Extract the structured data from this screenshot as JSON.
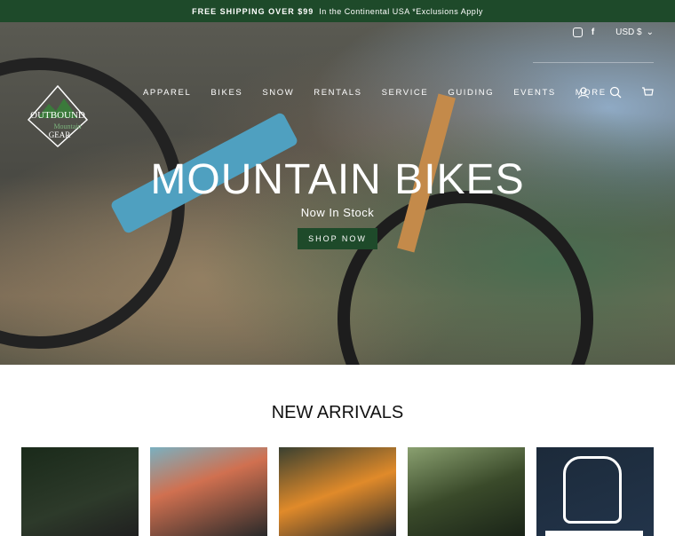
{
  "announcement": {
    "strong": "FREE SHIPPING OVER $99",
    "rest": "In the Continental USA *Exclusions Apply"
  },
  "header": {
    "currency": "USD $",
    "logo_alt": "Outbound Mountain Gear",
    "nav": [
      "APPAREL",
      "BIKES",
      "SNOW",
      "RENTALS",
      "SERVICE",
      "GUIDING",
      "EVENTS",
      "MORE"
    ]
  },
  "hero": {
    "title": "MOUNTAIN BIKES",
    "subtitle": "Now In Stock",
    "cta": "SHOP NOW"
  },
  "section": {
    "title": "NEW ARRIVALS"
  },
  "colors": {
    "brand_green": "#1e4a2a"
  }
}
